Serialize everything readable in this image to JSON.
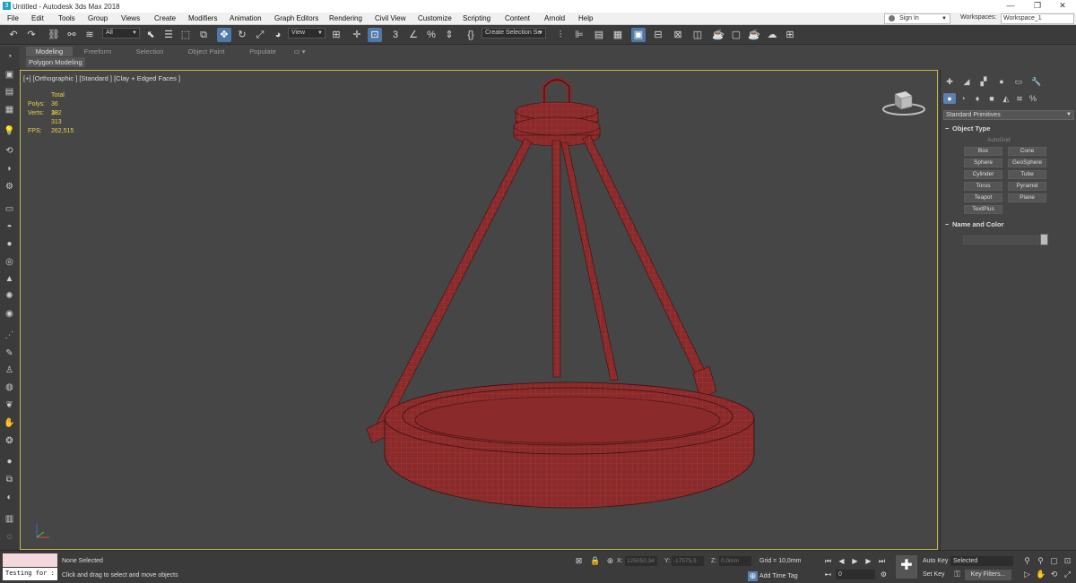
{
  "window": {
    "title": "Untitled - Autodesk 3ds Max 2018",
    "controls": [
      "—",
      "❐",
      "✕"
    ]
  },
  "menubar": {
    "items": [
      "File",
      "Edit",
      "Tools",
      "Group",
      "Views",
      "Create",
      "Modifiers",
      "Animation",
      "Graph Editors",
      "Rendering",
      "Civil View",
      "Customize",
      "Scripting",
      "Content",
      "Arnold",
      "Help"
    ],
    "signin": "Sign In",
    "workspaces_label": "Workspaces:",
    "workspace_value": "Workspace_1"
  },
  "toolbar": {
    "selection_filter": "All",
    "reference_coord": "View",
    "named_selection": "Create Selection Se",
    "snap_value": "3"
  },
  "ribbon": {
    "tabs": [
      "Modeling",
      "Freeform",
      "Selection",
      "Object Paint",
      "Populate"
    ],
    "active_tab": "Modeling",
    "subpanel": "Polygon Modeling"
  },
  "viewport": {
    "label": "[+] [Orthographic ] [Standard ] [Clay + Edged Faces ]",
    "stats": {
      "total_label": "Total",
      "polys_label": "Polys:",
      "polys_value": "36 302",
      "verts_label": "Verts:",
      "verts_value": "18 313",
      "fps_label": "FPS:",
      "fps_value": "262,515"
    },
    "model_color": "#8a2a2a",
    "wire_color": "#c24a4a"
  },
  "command_panel": {
    "category": "Standard Primitives",
    "object_type_label": "Object Type",
    "autogrid_label": "AutoGrid",
    "buttons": [
      "Box",
      "Cone",
      "Sphere",
      "GeoSphere",
      "Cylinder",
      "Tube",
      "Torus",
      "Pyramid",
      "Teapot",
      "Plane",
      "TextPlus"
    ],
    "name_color_label": "Name and Color"
  },
  "statusbar": {
    "script_input": "Testing for :",
    "selection_status": "None Selected",
    "prompt": "Click and drag to select and move objects",
    "x_label": "X:",
    "x_value": "125050,34",
    "y_label": "Y:",
    "y_value": "-17575,9",
    "z_label": "Z:",
    "z_value": "0,0mm",
    "grid": "Grid = 10,0mm",
    "add_time_tag": "Add Time Tag",
    "frame_value": "0",
    "auto_key": "Auto Key",
    "set_key": "Set Key",
    "selected_dropdown": "Selected",
    "key_filters": "Key Filters..."
  }
}
